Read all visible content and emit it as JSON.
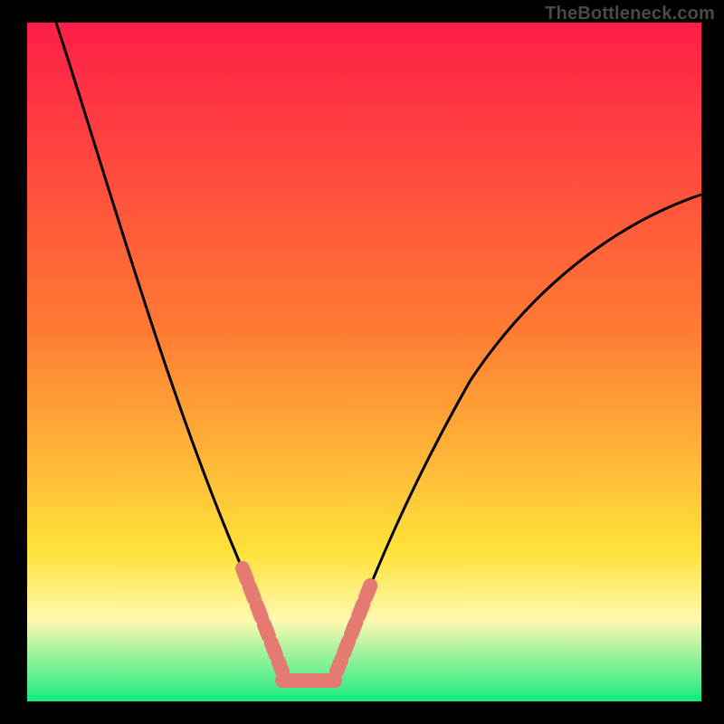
{
  "watermark": "TheBottleneck.com",
  "colors": {
    "background": "#000000",
    "gradient_top": "#ff1e48",
    "gradient_mid1": "#ff7a33",
    "gradient_mid2": "#ffe23a",
    "gradient_band_pale": "#fff8b0",
    "gradient_bottom": "#19ea7f",
    "curve": "#000000",
    "marker": "#e47a72",
    "watermark": "#4a4a4a"
  },
  "chart_data": {
    "type": "line",
    "title": "",
    "xlabel": "",
    "ylabel": "",
    "xlim": [
      0,
      100
    ],
    "ylim": [
      0,
      100
    ],
    "series": [
      {
        "name": "bottleneck-curve",
        "x": [
          0,
          5,
          10,
          15,
          20,
          25,
          28,
          30,
          32,
          34,
          36,
          38,
          40,
          42,
          44,
          48,
          52,
          56,
          60,
          65,
          70,
          75,
          80,
          85,
          90,
          95,
          100
        ],
        "y": [
          100,
          85,
          70,
          56,
          42,
          28,
          19,
          12,
          6,
          2,
          0,
          0,
          0,
          0,
          3,
          12,
          25,
          36,
          45,
          53,
          59,
          63,
          66,
          68,
          70,
          71,
          72
        ]
      }
    ],
    "markers": [
      {
        "name": "left-marker-band",
        "x_range": [
          29,
          34
        ],
        "y_range": [
          5,
          18
        ]
      },
      {
        "name": "valley-marker-band",
        "x_range": [
          34,
          42
        ],
        "y_range": [
          0,
          3
        ]
      },
      {
        "name": "right-marker-band",
        "x_range": [
          43,
          48
        ],
        "y_range": [
          4,
          16
        ]
      }
    ],
    "note": "No axis ticks or numeric labels are rendered in the image; x/y values are normalized 0–100 estimates read from pixel positions."
  }
}
